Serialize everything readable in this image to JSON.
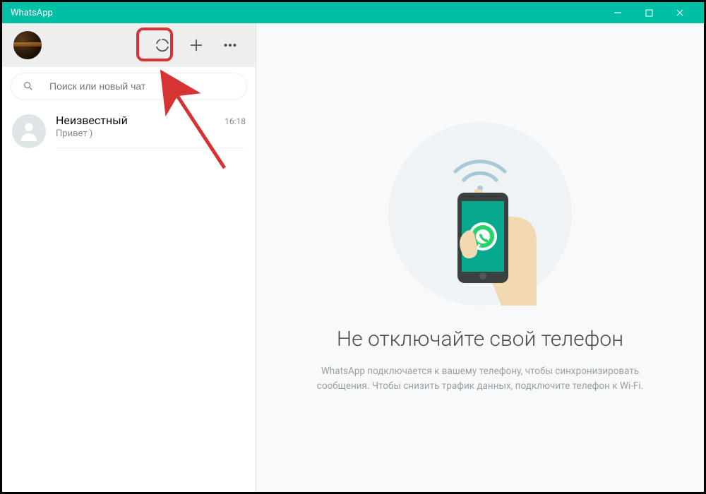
{
  "window": {
    "title": "WhatsApp"
  },
  "sidebar": {
    "search_placeholder": "Поиск или новый чат",
    "chats": [
      {
        "name": "Неизвестный",
        "preview": "Привет )",
        "time": "16:18"
      }
    ]
  },
  "empty_state": {
    "heading": "Не отключайте свой телефон",
    "body_line1": "WhatsApp подключается к вашему телефону, чтобы синхронизировать",
    "body_line2": "сообщения. Чтобы снизить трафик данных, подключите телефон к Wi-Fi."
  },
  "colors": {
    "accent": "#00bfa5",
    "highlight": "#d63333"
  }
}
